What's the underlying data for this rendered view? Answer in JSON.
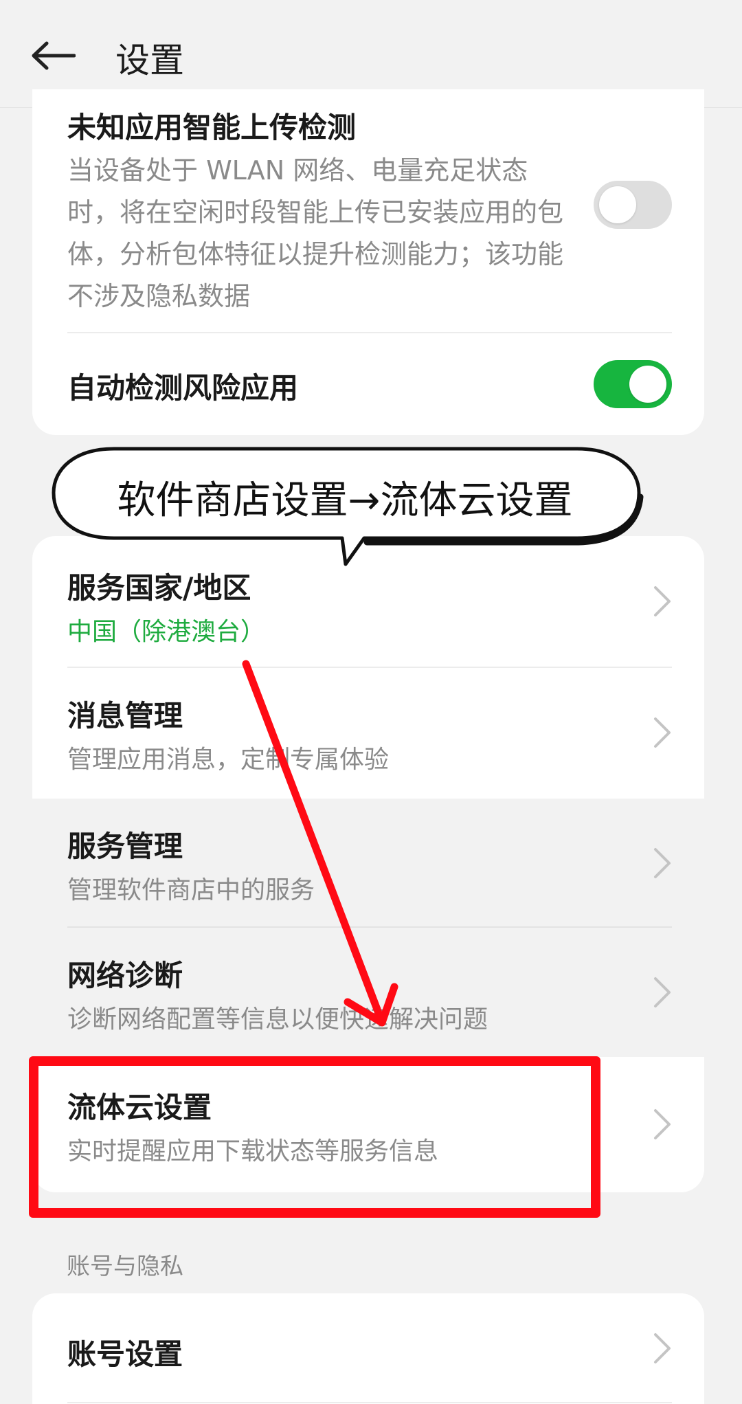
{
  "header": {
    "title": "设置"
  },
  "card1": {
    "upload": {
      "title": "未知应用智能上传检测",
      "desc": "当设备处于 WLAN 网络、电量充足状态时，将在空闲时段智能上传已安装应用的包体，分析包体特征以提升检测能力；该功能不涉及隐私数据",
      "toggle_on": false
    },
    "auto_detect": {
      "title": "自动检测风险应用",
      "toggle_on": true
    }
  },
  "annotation": {
    "bubble_text": "软件商店设置→流体云设置",
    "highlight_color": "#ff0a14"
  },
  "card2": {
    "items": [
      {
        "title": "服务国家/地区",
        "subtitle": "中国（除港澳台）"
      },
      {
        "title": "消息管理",
        "subtitle": "管理应用消息，定制专属体验"
      },
      {
        "title": "服务管理",
        "subtitle": "管理软件商店中的服务"
      },
      {
        "title": "网络诊断",
        "subtitle": "诊断网络配置等信息以便快速解决问题"
      },
      {
        "title": "流体云设置",
        "subtitle": "实时提醒应用下载状态等服务信息"
      }
    ]
  },
  "section": {
    "label": "账号与隐私"
  },
  "card3": {
    "items": [
      {
        "title": "账号设置"
      }
    ]
  },
  "colors": {
    "accent_green": "#17b53f",
    "subtitle_green": "#1eab3f",
    "annotation_red": "#ff0a14"
  }
}
